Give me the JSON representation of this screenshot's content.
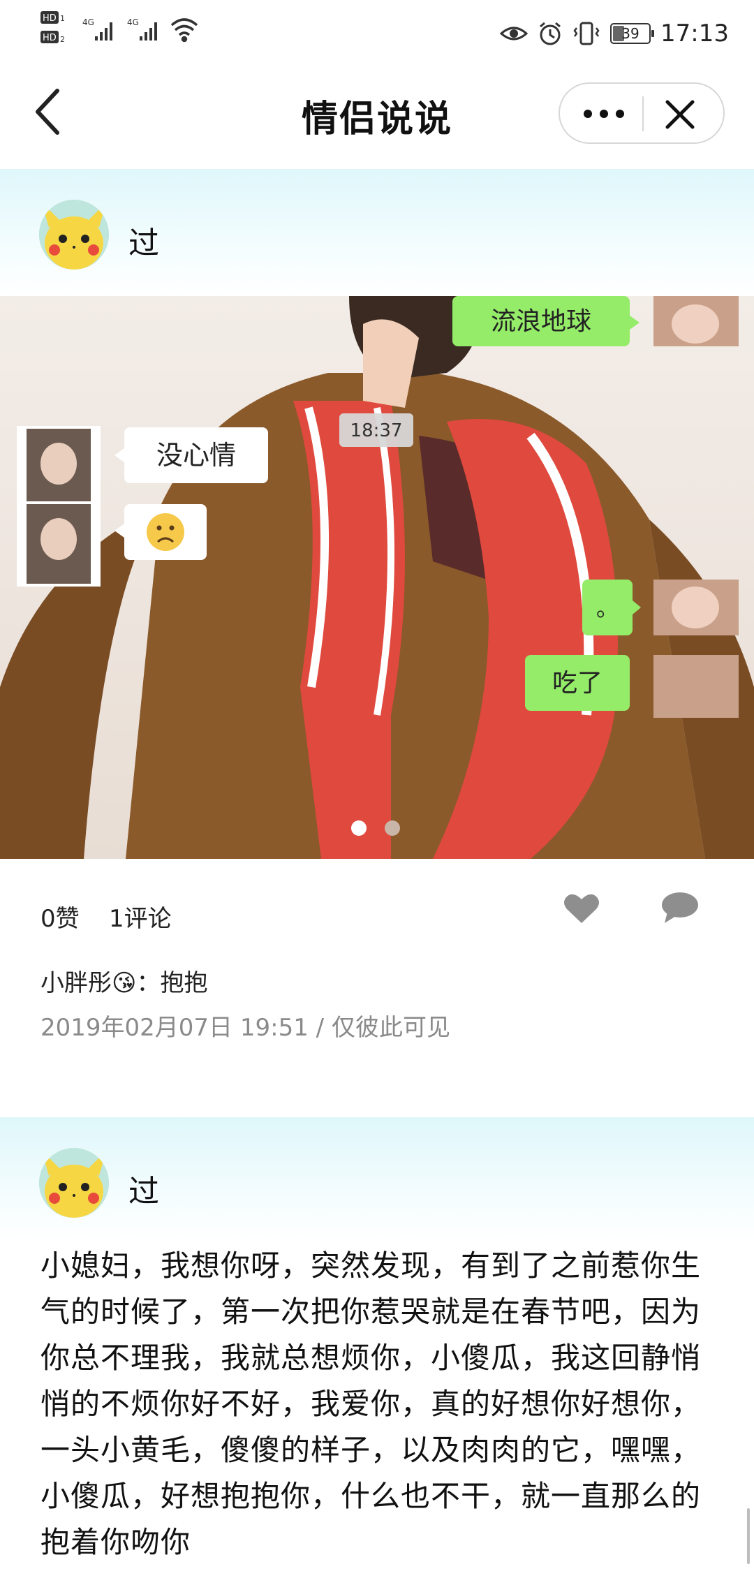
{
  "status_bar": {
    "left_icons": [
      "hd1-icon",
      "hd2-icon",
      "4g-signal-icon",
      "4g-signal-icon",
      "wifi-icon"
    ],
    "right_icons": [
      "eye-icon",
      "alarm-icon",
      "vibrate-icon",
      "battery-icon"
    ],
    "battery": "39",
    "time": "17:13"
  },
  "header": {
    "title": "情侣说说"
  },
  "posts": [
    {
      "username": "过",
      "photo": {
        "time_stamp": "18:37",
        "bubbles": [
          "流浪地球",
          "没心情",
          "。",
          "吃了"
        ],
        "page_count": 2,
        "current_page": 1
      },
      "likes": "0赞",
      "comments_count": "1评论",
      "comment_author": "小胖彤😘",
      "comment_text": "抱抱",
      "date": "2019年02月07日 19:51",
      "separator": "/",
      "visibility": "仅彼此可见"
    },
    {
      "username": "过",
      "text": "小媳妇，我想你呀，突然发现，有到了之前惹你生气的时候了，第一次把你惹哭就是在春节吧，因为你总不理我，我就总想烦你，小傻瓜，我这回静悄悄的不烦你好不好，我爱你，真的好想你好想你，一头小黄毛，傻傻的样子，以及肉肉的它，嘿嘿，小傻瓜，好想抱抱你，什么也不干，就一直那么的抱着你吻你"
    }
  ],
  "colors": {
    "post_header_bg": "#dff7fb",
    "chat_green": "#95ec69",
    "scarf_red": "#e0493e",
    "jacket_brown": "#8b5a2b"
  }
}
